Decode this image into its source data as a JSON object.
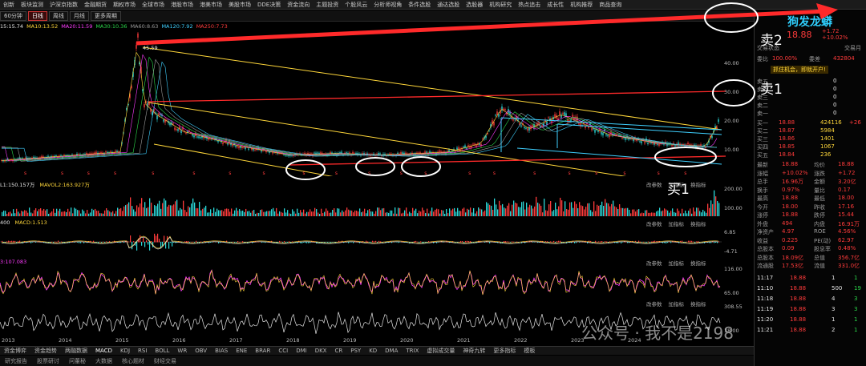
{
  "topnav": [
    "创新",
    "板块监测",
    "沪深京指数",
    "金融期货",
    "期权市场",
    "全球市场",
    "港股市场",
    "港美市场",
    "美股市场",
    "DDE决策",
    "资金流向",
    "主题投资",
    "个股风云",
    "分析师视角",
    "条件选股",
    "通达选股",
    "选股器",
    "机构研究",
    "热点追击",
    "成长性",
    "机构推荐",
    "商品查询"
  ],
  "periods": [
    "60分钟",
    "日线",
    "周线",
    "月线",
    "更多周期"
  ],
  "active_period": "日线",
  "ma_legend": [
    {
      "t": "15:15.74",
      "c": "#e6e6e6"
    },
    {
      "t": "MA10:13.52",
      "c": "#ffd73a"
    },
    {
      "t": "MA20:11.59",
      "c": "#ff3bff"
    },
    {
      "t": "MA30:10.36",
      "c": "#2bd74a"
    },
    {
      "t": "MA60:8.63",
      "c": "#9a9a9a"
    },
    {
      "t": "MA120:7.92",
      "c": "#3fd0ff"
    },
    {
      "t": "MA250:7.73",
      "c": "#ff3b3b"
    }
  ],
  "peak_label": "45.59",
  "price_axis": [
    "40.00",
    "30.00",
    "20.00",
    "10.00"
  ],
  "years": [
    "2013",
    "2014",
    "2015",
    "2016",
    "2017",
    "2018",
    "2019",
    "2020",
    "2021",
    "2022",
    "2023",
    "2024"
  ],
  "vol_header": "L1:150.157万",
  "vol_ma": "MAVOL2:163.927万",
  "vol_axis": [
    "200.00",
    "100.00"
  ],
  "macd_header": "400",
  "macd_val": "MACD:1.513",
  "macd_axis": [
    "6.85",
    "-4.71"
  ],
  "ind3_header": "3:107.083",
  "ind3_axis": [
    "116.00",
    "65.00"
  ],
  "ind4_axis": [
    "308.55",
    "18.00"
  ],
  "tools": [
    "改参数",
    "加指标",
    "换指标"
  ],
  "bottom_tabs": [
    "资金博弈",
    "资金趋势",
    "两融数据",
    "MACD",
    "KDJ",
    "RSI",
    "BOLL",
    "WR",
    "OBV",
    "BIAS",
    "ENE",
    "BRAR",
    "CCI",
    "DMI",
    "DKX",
    "CR",
    "PSY",
    "KD",
    "DMA",
    "TRIX",
    "虚拟成交量",
    "神奇九转",
    "更多指标",
    "模板"
  ],
  "bottom_active": "MACD",
  "bottom_tabs2": [
    "研究报告",
    "股票研讨",
    "问董秘",
    "大数据",
    "核心题材",
    "财经交易"
  ],
  "side": {
    "name": "狗发龙蟒",
    "price": "18.88",
    "chg": "+1.72",
    "pct": "+10.02%",
    "status": "交易状态",
    "trade_tag": "交易月",
    "weibi_label": "委比",
    "weibi": "100.00%",
    "weicha_label": "委差",
    "weicha": "432804",
    "banner": "抓住机会，即就开户!",
    "asks": [
      {
        "l": "卖五",
        "p": "",
        "v": "0"
      },
      {
        "l": "卖四",
        "p": "",
        "v": "0"
      },
      {
        "l": "卖三",
        "p": "",
        "v": "0"
      },
      {
        "l": "卖二",
        "p": "",
        "v": "0"
      },
      {
        "l": "卖一",
        "p": "",
        "v": "0"
      }
    ],
    "bids": [
      {
        "l": "买一",
        "p": "18.88",
        "v": "424116",
        "x": "+26"
      },
      {
        "l": "买二",
        "p": "18.87",
        "v": "5984",
        "x": ""
      },
      {
        "l": "买三",
        "p": "18.86",
        "v": "1401",
        "x": ""
      },
      {
        "l": "买四",
        "p": "18.85",
        "v": "1067",
        "x": ""
      },
      {
        "l": "买五",
        "p": "18.84",
        "v": "236",
        "x": ""
      }
    ],
    "stats": [
      [
        "最新",
        "18.88",
        "均价",
        "18.88"
      ],
      [
        "涨幅",
        "+10.02%",
        "涨跌",
        "+1.72"
      ],
      [
        "总手",
        "16.96万",
        "金额",
        "3.20亿"
      ],
      [
        "换手",
        "0.97%",
        "量比",
        "0.17"
      ],
      [
        "最高",
        "18.88",
        "最低",
        "18.00"
      ],
      [
        "今开",
        "18.00",
        "昨收",
        "17.16"
      ],
      [
        "涨停",
        "18.88",
        "跌停",
        "15.44"
      ],
      [
        "外盘",
        "494",
        "内盘",
        "16.91万"
      ],
      [
        "净资产",
        "4.97",
        "ROE",
        "4.56%"
      ],
      [
        "收益",
        "0.225",
        "PE(动)",
        "62.97"
      ],
      [
        "总股本",
        "0.09",
        "股息率",
        "0.48%"
      ],
      [
        "总股本",
        "18.09亿",
        "总值",
        "356.7亿"
      ],
      [
        "流通股",
        "17.53亿",
        "流值",
        "331.0亿"
      ]
    ],
    "ticks": [
      [
        "11:17",
        "18.88",
        "1",
        "1"
      ],
      [
        "11:10",
        "18.88",
        "500",
        "19"
      ],
      [
        "11:18",
        "18.88",
        "4",
        "3"
      ],
      [
        "11:19",
        "18.88",
        "3",
        "3"
      ],
      [
        "11:20",
        "18.88",
        "1",
        "1"
      ],
      [
        "11:21",
        "18.88",
        "2",
        "1"
      ]
    ]
  },
  "annotations": {
    "sell2": "卖2",
    "sell1": "卖1",
    "buy1": "买1"
  },
  "watermark": "公众号 · 我不是2198"
}
